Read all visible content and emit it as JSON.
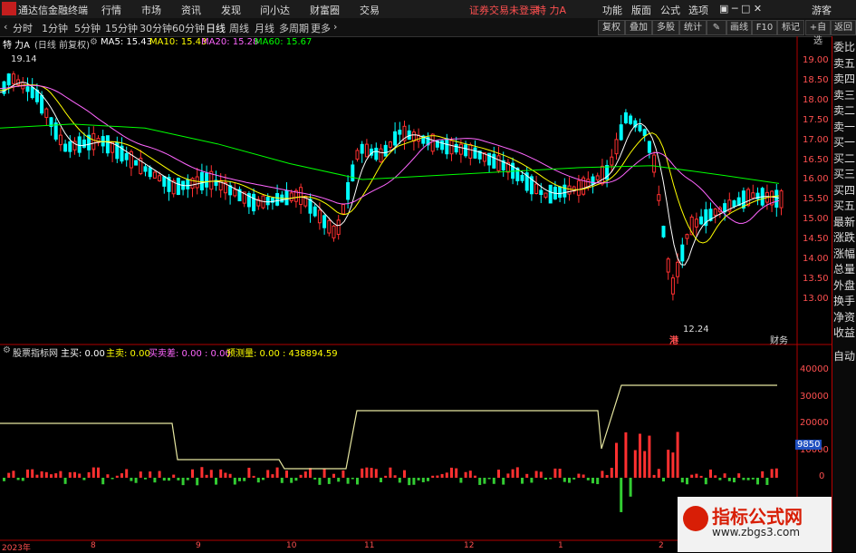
{
  "menubar": {
    "app_name": "通达信金融终端",
    "items": [
      "行情",
      "市场",
      "资讯",
      "发现",
      "问小达",
      "财富圈",
      "交易"
    ],
    "login_status": "证券交易未登录",
    "stock_name": "特 力A",
    "right_items": [
      "功能",
      "版面",
      "公式",
      "选项",
      "游客"
    ]
  },
  "toolbar": {
    "periods": [
      "分时",
      "1分钟",
      "5分钟",
      "15分钟",
      "30分钟",
      "60分钟",
      "日线",
      "周线",
      "月线",
      "多周期",
      "更多"
    ],
    "active_period": "日线",
    "right_buttons": [
      "复权",
      "叠加",
      "多股",
      "统计",
      "画线",
      "F10",
      "标记",
      "+自选",
      "返回"
    ]
  },
  "sidebar": {
    "items": [
      "委比",
      "卖五",
      "卖四",
      "卖三",
      "卖二",
      "卖一",
      "买一",
      "买二",
      "买三",
      "买四",
      "买五",
      "最新",
      "涨跌",
      "涨幅",
      "总量",
      "外盘",
      "换手",
      "净资",
      "收益",
      "自动"
    ]
  },
  "upper_chart": {
    "title": "特 力A",
    "mode": "(日线 前复权)",
    "indicators": [
      {
        "label": "MA5: 15.43",
        "color": "#ffffff"
      },
      {
        "label": "MA10: 15.43",
        "color": "#ffff00"
      },
      {
        "label": "MA20: 15.28",
        "color": "#ff66ff"
      },
      {
        "label": "MA60: 15.67",
        "color": "#00ff00"
      }
    ],
    "high_marker": "19.14",
    "low_marker": "12.24",
    "low_tag": "港",
    "finance_tag": "财务",
    "price_axis": [
      "19.00",
      "18.50",
      "18.00",
      "17.50",
      "17.00",
      "16.50",
      "16.00",
      "15.50",
      "15.00",
      "14.50",
      "14.00",
      "13.50",
      "13.00"
    ],
    "colors": {
      "up": "#ff3030",
      "down": "#00ffff",
      "ma5": "#ffffff",
      "ma10": "#ffff00",
      "ma20": "#ff66ff",
      "ma60": "#00ff00"
    }
  },
  "lower_chart": {
    "title": "股票指标网",
    "labels": [
      {
        "label": "主买: 0.00",
        "color": "#ffffff"
      },
      {
        "label": "主卖: 0.00",
        "color": "#ffff00"
      },
      {
        "label": "买卖差: 0.00 : 0.00",
        "color": "#ff66ff"
      },
      {
        "label": "预测量: 0.00 : 438894.59",
        "color": "#ffff00"
      }
    ],
    "value_axis": [
      "40000",
      "30000",
      "20000",
      "10000",
      "0"
    ],
    "tag_value": "9850"
  },
  "x_axis": [
    "2023年",
    "8",
    "9",
    "10",
    "11",
    "12",
    "1",
    "2"
  ],
  "watermark": {
    "title": "指标公式网",
    "url": "www.zbgs3.com"
  }
}
